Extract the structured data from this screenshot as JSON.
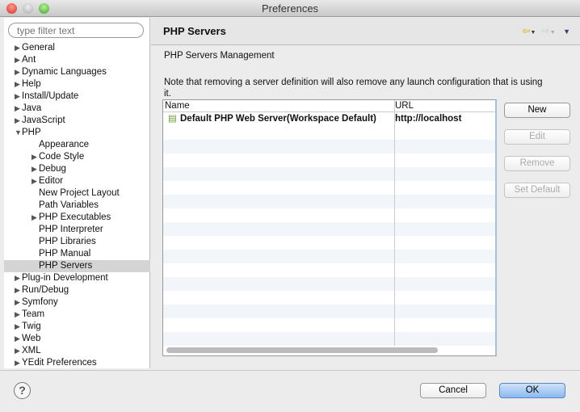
{
  "window": {
    "title": "Preferences"
  },
  "filter": {
    "placeholder": "type filter text"
  },
  "tree": [
    {
      "label": "General",
      "level": 0,
      "arrow": "right"
    },
    {
      "label": "Ant",
      "level": 0,
      "arrow": "right"
    },
    {
      "label": "Dynamic Languages",
      "level": 0,
      "arrow": "right"
    },
    {
      "label": "Help",
      "level": 0,
      "arrow": "right"
    },
    {
      "label": "Install/Update",
      "level": 0,
      "arrow": "right"
    },
    {
      "label": "Java",
      "level": 0,
      "arrow": "right"
    },
    {
      "label": "JavaScript",
      "level": 0,
      "arrow": "right"
    },
    {
      "label": "PHP",
      "level": 0,
      "arrow": "down"
    },
    {
      "label": "Appearance",
      "level": 1,
      "arrow": ""
    },
    {
      "label": "Code Style",
      "level": 1,
      "arrow": "right"
    },
    {
      "label": "Debug",
      "level": 1,
      "arrow": "right"
    },
    {
      "label": "Editor",
      "level": 1,
      "arrow": "right"
    },
    {
      "label": "New Project Layout",
      "level": 1,
      "arrow": ""
    },
    {
      "label": "Path Variables",
      "level": 1,
      "arrow": ""
    },
    {
      "label": "PHP Executables",
      "level": 1,
      "arrow": "right"
    },
    {
      "label": "PHP Interpreter",
      "level": 1,
      "arrow": ""
    },
    {
      "label": "PHP Libraries",
      "level": 1,
      "arrow": ""
    },
    {
      "label": "PHP Manual",
      "level": 1,
      "arrow": ""
    },
    {
      "label": "PHP Servers",
      "level": 1,
      "arrow": "",
      "selected": true
    },
    {
      "label": "Plug-in Development",
      "level": 0,
      "arrow": "right"
    },
    {
      "label": "Run/Debug",
      "level": 0,
      "arrow": "right"
    },
    {
      "label": "Symfony",
      "level": 0,
      "arrow": "right"
    },
    {
      "label": "Team",
      "level": 0,
      "arrow": "right"
    },
    {
      "label": "Twig",
      "level": 0,
      "arrow": "right"
    },
    {
      "label": "Web",
      "level": 0,
      "arrow": "right"
    },
    {
      "label": "XML",
      "level": 0,
      "arrow": "right"
    },
    {
      "label": "YEdit Preferences",
      "level": 0,
      "arrow": "right"
    }
  ],
  "page": {
    "title": "PHP Servers",
    "subtitle": "PHP Servers Management",
    "note_line1": "Note that removing a server definition will also remove any launch configuration that is using",
    "note_line2": "it."
  },
  "table": {
    "columns": [
      "Name",
      "URL"
    ],
    "rows": [
      {
        "name": "Default PHP Web Server(Workspace Default)",
        "url": "http://localhost"
      }
    ]
  },
  "buttons": {
    "new": "New",
    "edit": "Edit",
    "remove": "Remove",
    "set_default": "Set Default"
  },
  "footer": {
    "help": "?",
    "cancel": "Cancel",
    "ok": "OK"
  }
}
